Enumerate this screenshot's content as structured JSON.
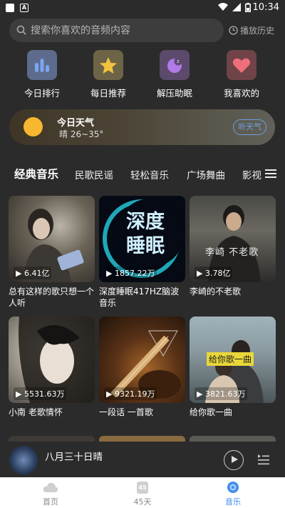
{
  "status_bar": {
    "time": "10:34"
  },
  "search": {
    "placeholder": "搜索你喜欢的音频内容",
    "history_label": "播放历史"
  },
  "quick_links": [
    {
      "label": "今日排行",
      "icon": "bar-chart-icon",
      "color": "#5b7ec6"
    },
    {
      "label": "每日推荐",
      "icon": "star-icon",
      "color": "#e8b93a"
    },
    {
      "label": "解压助眠",
      "icon": "moon-icon",
      "color": "#9a5fd0"
    },
    {
      "label": "我喜欢的",
      "icon": "heart-icon",
      "color": "#e06b75"
    }
  ],
  "weather": {
    "title": "今日天气",
    "condition": "晴 26~35°",
    "button_label": "听天气"
  },
  "tabs": [
    "经典音乐",
    "民歌民谣",
    "轻松音乐",
    "广场舞曲",
    "影视"
  ],
  "albums": [
    {
      "title": "总有这样的歌只想一个人听",
      "plays": "6.41亿"
    },
    {
      "title": "深度睡眠417HZ脑波音乐",
      "plays": "1857.22万",
      "cover_text": [
        "深度",
        "睡眠"
      ]
    },
    {
      "title": "李崎的不老歌",
      "plays": "3.78亿",
      "cover_text": [
        "李崎",
        "不老歌"
      ]
    },
    {
      "title": "小南 老歌情怀",
      "plays": "5531.63万"
    },
    {
      "title": "一段话 一首歌",
      "plays": "9321.19万"
    },
    {
      "title": "给你歌一曲",
      "plays": "3821.63万",
      "cover_text": [
        "给你歌一曲"
      ]
    }
  ],
  "player": {
    "title": "八月三十日晴"
  },
  "bottom_nav": [
    {
      "label": "首页",
      "icon": "cloud-icon"
    },
    {
      "label": "45天",
      "icon": "calendar-icon",
      "badge": "45"
    },
    {
      "label": "音乐",
      "icon": "music-disc-icon",
      "active": true
    }
  ],
  "colors": {
    "background": "#2b2b2b",
    "accent": "#3f8cf0",
    "weather_button": "#6f9fe2"
  }
}
